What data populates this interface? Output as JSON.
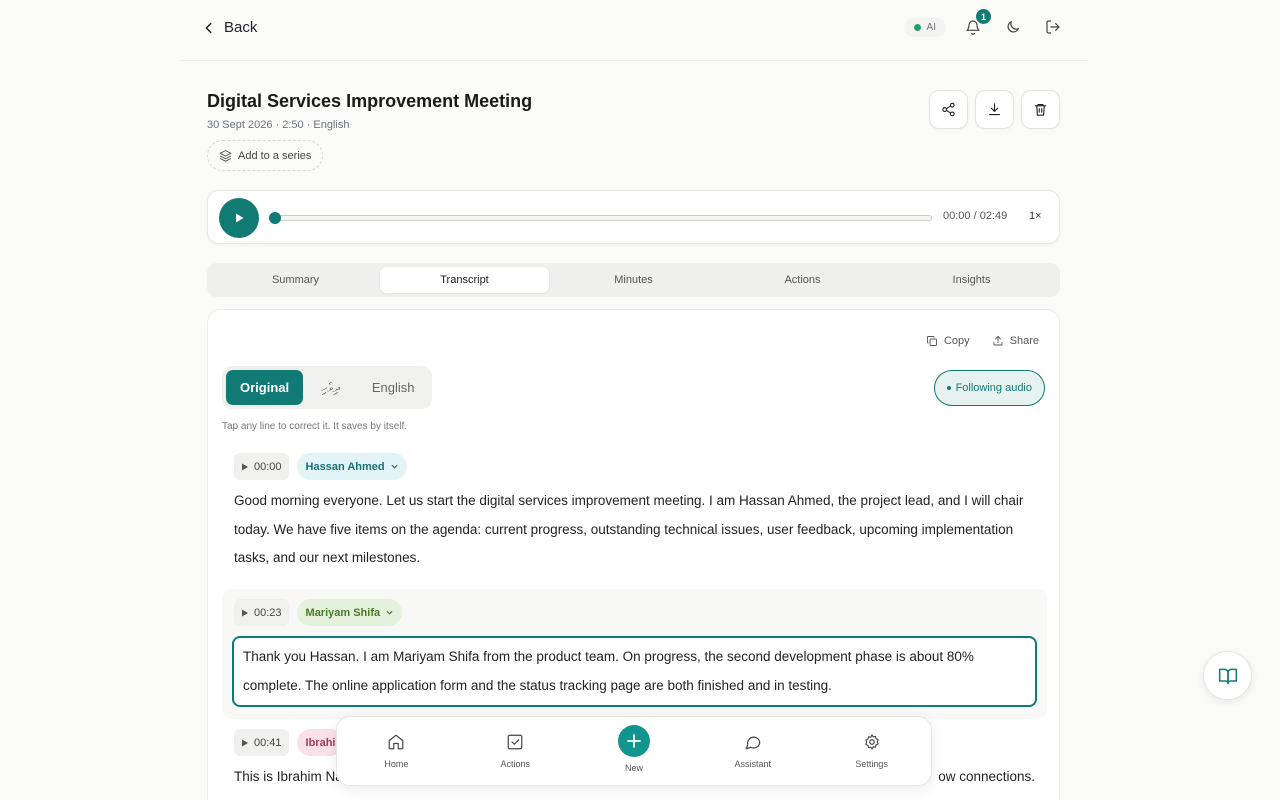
{
  "header": {
    "back_label": "Back",
    "ai_label": "AI",
    "notification_count": "1"
  },
  "meeting": {
    "title": "Digital Services Improvement Meeting",
    "meta": "30 Sept 2026 · 2:50 · English",
    "add_series_label": "Add to a series"
  },
  "player": {
    "time": "00:00 / 02:49",
    "speed": "1×",
    "progress": 0
  },
  "tabs": [
    {
      "label": "Summary",
      "active": false
    },
    {
      "label": "Transcript",
      "active": true
    },
    {
      "label": "Minutes",
      "active": false
    },
    {
      "label": "Actions",
      "active": false
    },
    {
      "label": "Insights",
      "active": false
    }
  ],
  "transcript": {
    "copy_label": "Copy",
    "share_label": "Share",
    "lang_original": "Original",
    "lang_dhivehi": "ދިވެހި",
    "lang_english": "English",
    "following_label": "Following audio",
    "hint": "Tap any line to correct it. It saves by itself.",
    "segments": [
      {
        "time": "00:00",
        "speaker": "Hassan Ahmed",
        "text": "Good morning everyone. Let us start the digital services improvement meeting. I am Hassan Ahmed, the project lead, and I will chair today. We have five items on the agenda: current progress, outstanding technical issues, user feedback, upcoming implementation tasks, and our next milestones."
      },
      {
        "time": "00:23",
        "speaker": "Mariyam Shifa",
        "text": "Thank you Hassan. I am Mariyam Shifa from the product team. On progress, the second development phase is about 80% complete. The online application form and the status tracking page are both finished and in testing."
      },
      {
        "time": "00:41",
        "speaker": "Ibrahi",
        "text": "This is Ibrahim Na",
        "text_tail": "ow connections."
      }
    ]
  },
  "nav": {
    "home": "Home",
    "actions": "Actions",
    "new": "New",
    "assistant": "Assistant",
    "settings": "Settings"
  },
  "colors": {
    "accent": "#127a74",
    "background": "#fafaf8"
  }
}
